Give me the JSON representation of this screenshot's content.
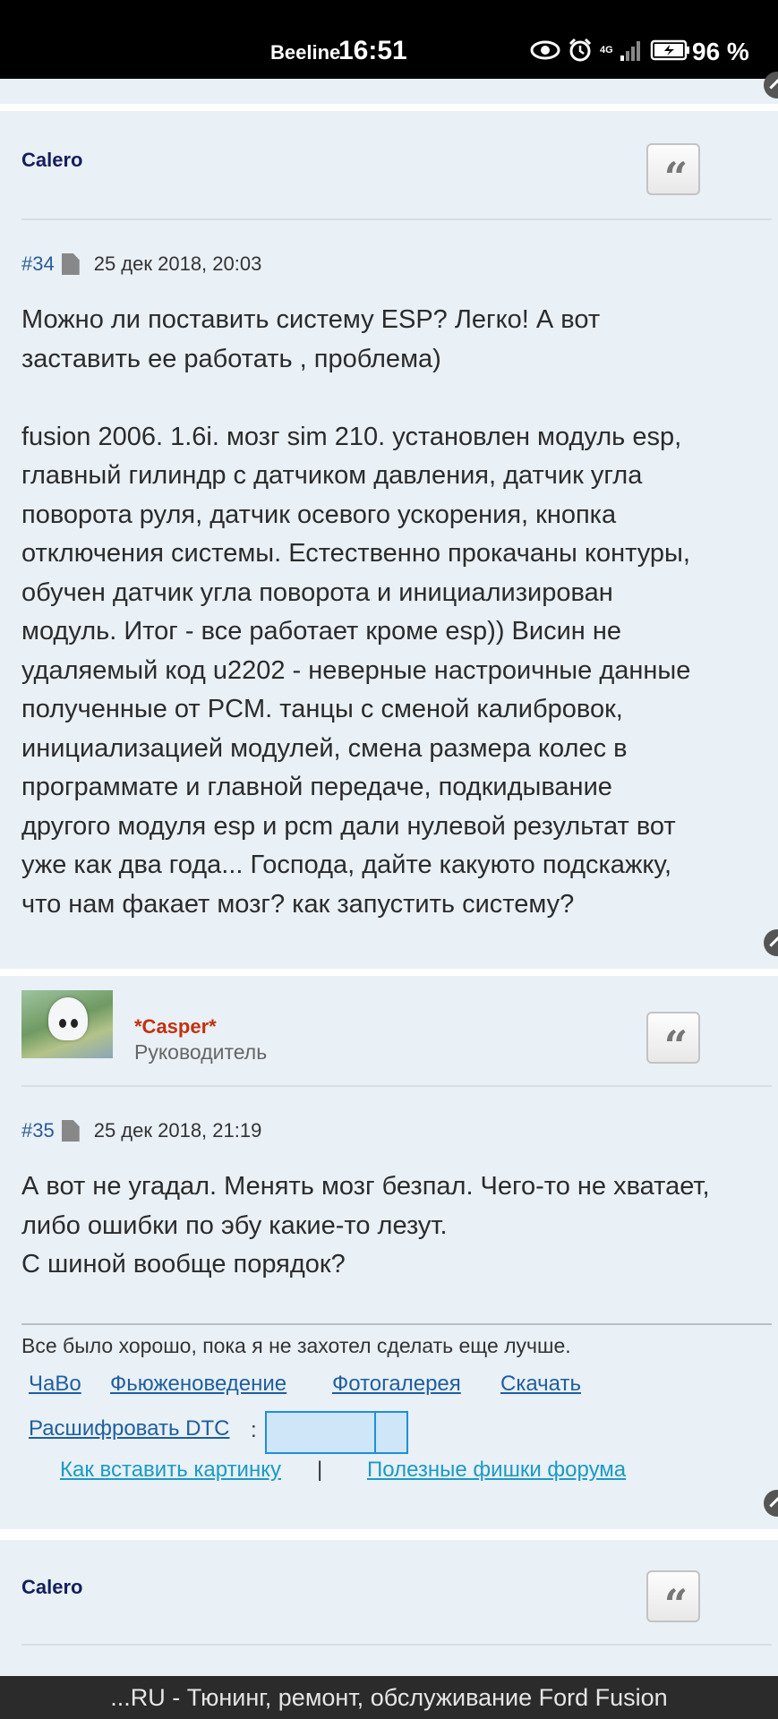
{
  "status_bar": {
    "carrier": "Beeline",
    "time": "16:51",
    "network": "4G",
    "battery": "96 %"
  },
  "posts": [
    {
      "author": "Calero",
      "quote_icon": "quote-icon"
    },
    {
      "number": "#34",
      "date": "25 дек 2018, 20:03",
      "text": "Можно ли поставить систему ESP? Легко! А вот\nзаставить ее работать , проблема)\n\nfusion 2006. 1.6i. мозг sim 210. установлен модуль esp,\nглавный гилиндр с датчиком давления, датчик угла\nповорота руля, датчик осевого ускорения, кнопка\nотключения системы. Естественно прокачаны контуры,\nобучен датчик угла поворота и инициализирован\nмодуль. Итог - все работает кроме esp)) Висин не\nудаляемый код u2202 - неверные настроичные данные\nполученные от PCM. танцы с сменой калибровок,\nинициализацией модулей, смена размера колес в\nпрограммате и главной передаче, подкидывание\nдругого модуля esp и pcm дали нулевой результат вот\nуже как два года... Господа, дайте какуюто подскажку,\nчто нам факает мозг? как запустить систему?"
    },
    {
      "author": "*Casper*",
      "role": "Руководитель",
      "number": "#35",
      "date": "25 дек 2018, 21:19",
      "text": "А вот не угадал. Менять мозг безпал. Чего-то не хватает,\nлибо ошибки по эбу какие-то лезут.\nС шиной вообще порядок?",
      "signature": {
        "text": "Все было хорошо, пока я не захотел сделать еще лучше.",
        "links": [
          "ЧаВо",
          "Фьюженоведение",
          "Фотогалерея",
          "Скачать"
        ],
        "dtc_label": "Расшифровать DTC",
        "dtc_colon": ":",
        "link_insert_image": "Как вставить картинку",
        "separator": "|",
        "link_tips": "Полезные фишки форума"
      }
    },
    {
      "author": "Calero"
    }
  ],
  "footer": {
    "text": "...RU - Тюнинг, ремонт, обслуживание Ford Fusion"
  }
}
